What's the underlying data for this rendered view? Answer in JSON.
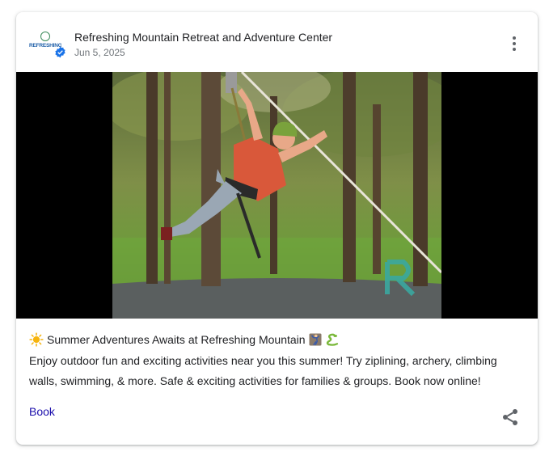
{
  "post": {
    "business_name": "Refreshing Mountain Retreat and Adventure Center",
    "date": "Jun 5, 2025",
    "logo_text": "REFRESHING MOUNTAIN",
    "title": "Summer Adventures Awaits at Refreshing Mountain",
    "title_icons": [
      "sun-emoji-icon",
      "person-climbing-emoji-icon",
      "snake-emoji-icon"
    ],
    "body": "Enjoy outdoor fun and exciting activities near you this summer! Try ziplining, archery, climbing walls, swimming, & more. Safe & exciting activities for families & groups. Book now online!",
    "action_label": "Book",
    "image_icon": "zipline-photo",
    "photo_watermark": "R"
  },
  "colors": {
    "link": "#1a0dab",
    "text": "#202124",
    "secondary_text": "#70757a",
    "verified_badge": "#1a73e8",
    "media_background": "#000000"
  }
}
